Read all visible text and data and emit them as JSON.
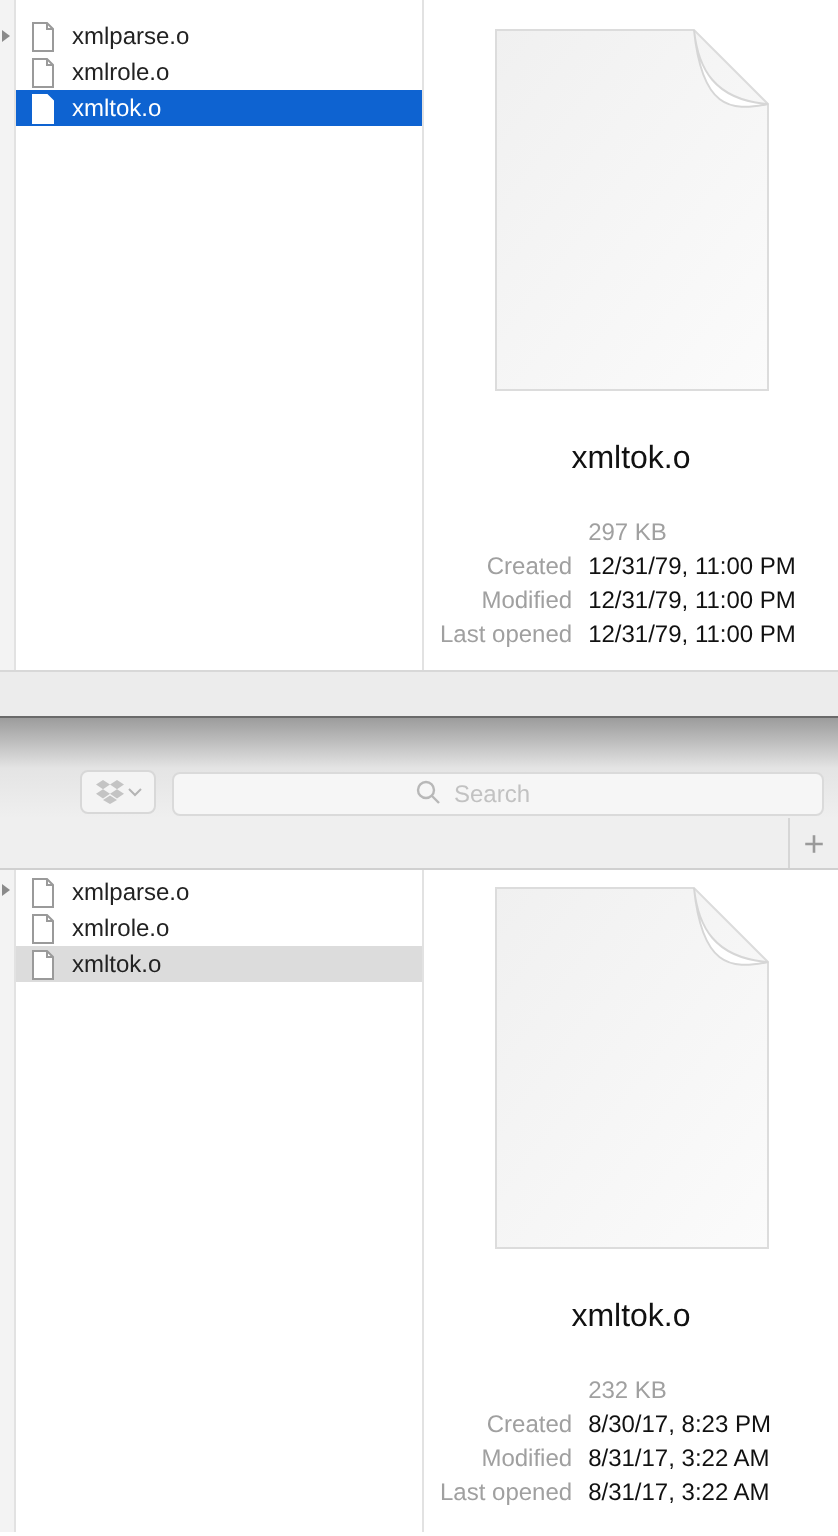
{
  "panes": [
    {
      "focused": true,
      "files": [
        {
          "name": "xmlparse.o",
          "selected": false
        },
        {
          "name": "xmlrole.o",
          "selected": false
        },
        {
          "name": "xmltok.o",
          "selected": true
        }
      ],
      "preview": {
        "name": "xmltok.o",
        "size": "297 KB",
        "info": [
          {
            "label": "Created",
            "value": "12/31/79, 11:00 PM"
          },
          {
            "label": "Modified",
            "value": "12/31/79, 11:00 PM"
          },
          {
            "label": "Last opened",
            "value": "12/31/79, 11:00 PM"
          }
        ]
      }
    },
    {
      "focused": false,
      "toolbar": {
        "search": {
          "placeholder": "Search"
        },
        "add_tab": "+"
      },
      "files": [
        {
          "name": "xmlparse.o",
          "selected": false
        },
        {
          "name": "xmlrole.o",
          "selected": false
        },
        {
          "name": "xmltok.o",
          "selected": true
        }
      ],
      "preview": {
        "name": "xmltok.o",
        "size": "232 KB",
        "info": [
          {
            "label": "Created",
            "value": "8/30/17, 8:23 PM"
          },
          {
            "label": "Modified",
            "value": "8/31/17, 3:22 AM"
          },
          {
            "label": "Last opened",
            "value": "8/31/17, 3:22 AM"
          }
        ]
      }
    }
  ]
}
